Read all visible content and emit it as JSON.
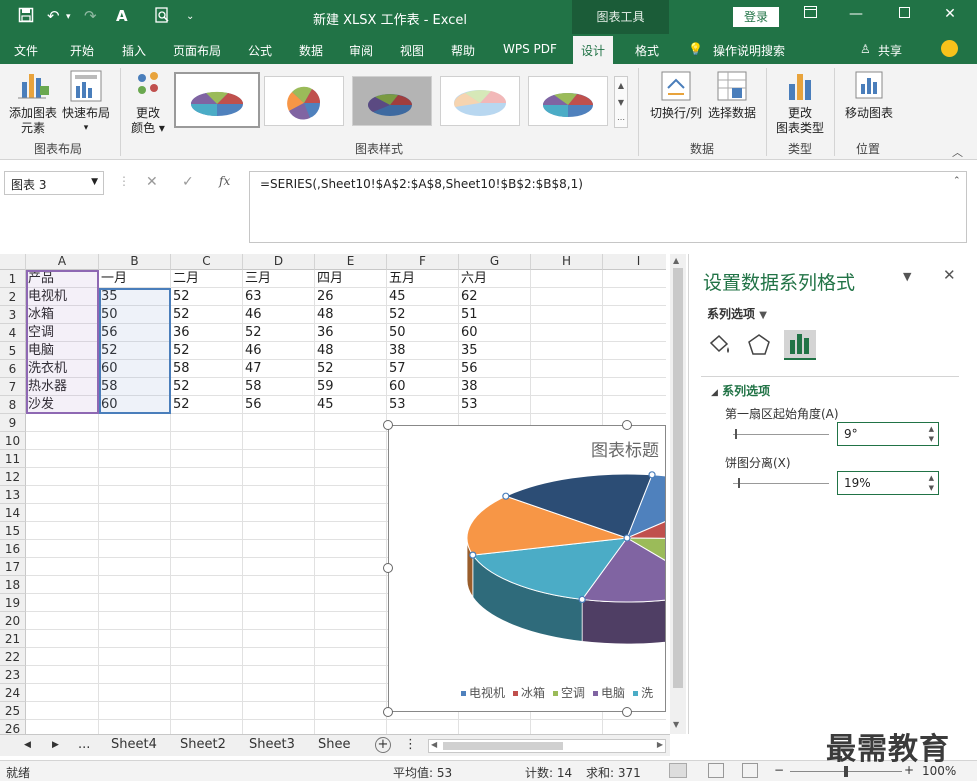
{
  "titlebar": {
    "title": "新建 XLSX 工作表  -  Excel",
    "context_tab": "图表工具",
    "login": "登录"
  },
  "tabs": [
    "文件",
    "开始",
    "插入",
    "页面布局",
    "公式",
    "数据",
    "审阅",
    "视图",
    "帮助",
    "WPS PDF",
    "设计",
    "格式"
  ],
  "active_tab": "设计",
  "tell_me": "操作说明搜索",
  "share": "共享",
  "ribbon": {
    "add_element": "添加图表",
    "add_element_2": "元素",
    "quick_layout": "快速布局",
    "change_color": "更改",
    "change_color_2": "颜色",
    "group_layout": "图表布局",
    "group_styles": "图表样式",
    "switch_rowcol": "切换行/列",
    "select_data": "选择数据",
    "group_data": "数据",
    "change_type": "更改",
    "change_type_2": "图表类型",
    "group_type": "类型",
    "move_chart": "移动图表",
    "group_location": "位置"
  },
  "formula_bar": {
    "name_box": "图表 3",
    "formula": "=SERIES(,Sheet10!$A$2:$A$8,Sheet10!$B$2:$B$8,1)"
  },
  "grid": {
    "columns": [
      "A",
      "B",
      "C",
      "D",
      "E",
      "F",
      "G",
      "H",
      "I"
    ],
    "rows": [
      "1",
      "2",
      "3",
      "4",
      "5",
      "6",
      "7",
      "8",
      "9",
      "10",
      "11",
      "12",
      "13",
      "14",
      "15",
      "16",
      "17",
      "18",
      "19",
      "20",
      "21",
      "22",
      "23",
      "24",
      "25",
      "26"
    ],
    "header": [
      "产品",
      "一月",
      "二月",
      "三月",
      "四月",
      "五月",
      "六月"
    ],
    "data": [
      [
        "电视机",
        "35",
        "52",
        "63",
        "26",
        "45",
        "62"
      ],
      [
        "冰箱",
        "50",
        "52",
        "46",
        "48",
        "52",
        "51"
      ],
      [
        "空调",
        "56",
        "36",
        "52",
        "36",
        "50",
        "60"
      ],
      [
        "电脑",
        "52",
        "52",
        "46",
        "48",
        "38",
        "35"
      ],
      [
        "洗衣机",
        "60",
        "58",
        "47",
        "52",
        "57",
        "56"
      ],
      [
        "热水器",
        "58",
        "52",
        "58",
        "59",
        "60",
        "38"
      ],
      [
        "沙发",
        "60",
        "52",
        "56",
        "45",
        "53",
        "53"
      ]
    ]
  },
  "chart": {
    "title": "图表标题",
    "legend": [
      "电视机",
      "冰箱",
      "空调",
      "电脑",
      "洗"
    ],
    "colors": [
      "#4f81bd",
      "#c0504d",
      "#9bbb59",
      "#8064a2",
      "#4bacc6",
      "#f79646",
      "#2c4d75"
    ]
  },
  "chart_data": {
    "type": "pie",
    "title": "图表标题",
    "categories": [
      "电视机",
      "冰箱",
      "空调",
      "电脑",
      "洗衣机",
      "热水器",
      "沙发"
    ],
    "values": [
      35,
      50,
      56,
      52,
      60,
      58,
      60
    ],
    "first_slice_angle": 9,
    "explosion": 19
  },
  "panel": {
    "title": "设置数据系列格式",
    "options_label": "系列选项",
    "section": "系列选项",
    "angle_label": "第一扇区起始角度(A)",
    "angle_value": "9°",
    "explode_label": "饼图分离(X)",
    "explode_value": "19%"
  },
  "sheets": [
    "Sheet4",
    "Sheet2",
    "Sheet3",
    "Shee"
  ],
  "sheet_more": "...",
  "status": {
    "ready": "就绪",
    "average": "平均值: 53",
    "count": "计数: 14",
    "sum": "求和: 371",
    "zoom": "100%"
  },
  "watermark": "最需教育"
}
